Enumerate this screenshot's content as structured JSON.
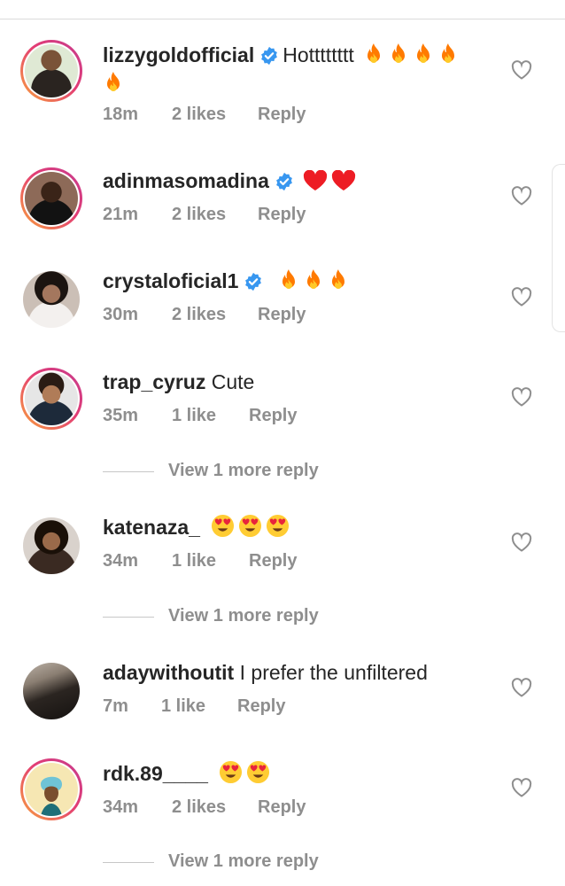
{
  "comments": [
    {
      "username": "lizzygoldofficial",
      "verified": true,
      "text": "Hotttttttt",
      "emoji": [
        "fire",
        "fire",
        "fire",
        "fire",
        "fire"
      ],
      "time": "18m",
      "likes": "2 likes",
      "reply": "Reply",
      "story_ring": true,
      "avatar_icon": "avatar-photo-icon"
    },
    {
      "username": "adinmasomadina",
      "verified": true,
      "text": "",
      "emoji": [
        "red-heart",
        "red-heart"
      ],
      "time": "21m",
      "likes": "2 likes",
      "reply": "Reply",
      "story_ring": true,
      "avatar_icon": "avatar-photo-icon"
    },
    {
      "username": "crystaloficial1",
      "verified": true,
      "text": "",
      "emoji": [
        "fire",
        "fire",
        "fire"
      ],
      "time": "30m",
      "likes": "2 likes",
      "reply": "Reply",
      "story_ring": false,
      "avatar_icon": "avatar-photo-icon"
    },
    {
      "username": "trap_cyruz",
      "verified": false,
      "text": "Cute",
      "emoji": [],
      "time": "35m",
      "likes": "1 like",
      "reply": "Reply",
      "story_ring": true,
      "avatar_icon": "avatar-photo-icon",
      "view_more": "View 1 more reply"
    },
    {
      "username": "katenaza_",
      "verified": false,
      "text": "",
      "emoji": [
        "heart-eyes",
        "heart-eyes",
        "heart-eyes"
      ],
      "time": "34m",
      "likes": "1 like",
      "reply": "Reply",
      "story_ring": false,
      "avatar_icon": "avatar-photo-icon",
      "view_more": "View 1 more reply"
    },
    {
      "username": "adaywithoutit",
      "verified": false,
      "text": "I prefer the unfiltered",
      "emoji": [],
      "time": "7m",
      "likes": "1 like",
      "reply": "Reply",
      "story_ring": false,
      "avatar_icon": "avatar-photo-icon"
    },
    {
      "username": "rdk.89____",
      "verified": false,
      "text": "",
      "emoji": [
        "heart-eyes",
        "heart-eyes"
      ],
      "time": "34m",
      "likes": "2 likes",
      "reply": "Reply",
      "story_ring": true,
      "avatar_icon": "avatar-illustration-icon",
      "view_more": "View 1 more reply"
    }
  ],
  "colors": {
    "text": "#262626",
    "secondary": "#8e8e8e",
    "verified_blue": "#3897f0",
    "fire": "#ff7a00",
    "heart_red": "#ed1c24",
    "emoji_yellow": "#ffcc33"
  }
}
